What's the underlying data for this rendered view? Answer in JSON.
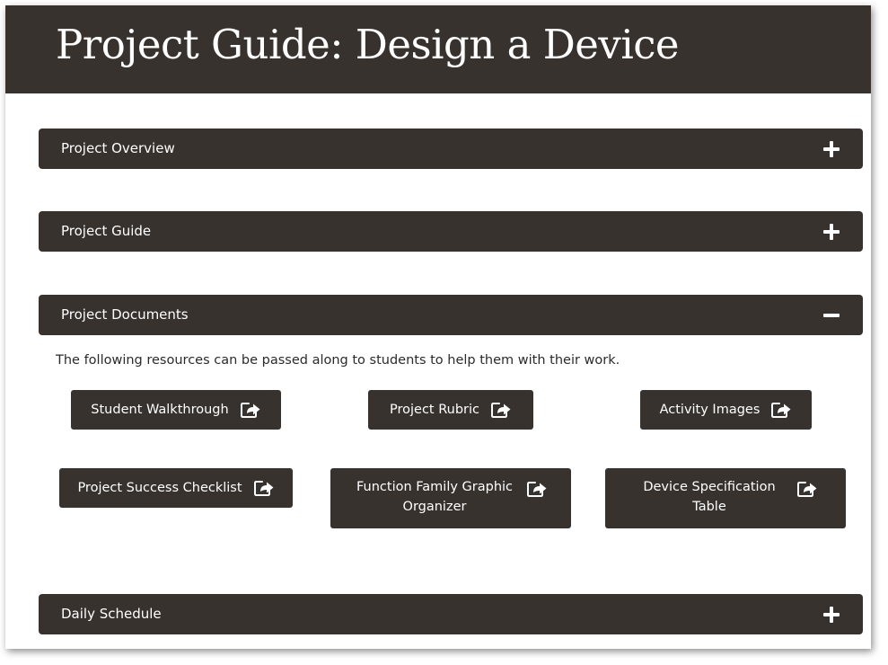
{
  "page": {
    "title": "Project Guide: Design a Device"
  },
  "accordion": [
    {
      "label": "Project Overview",
      "state": "collapsed",
      "toggle_icon": "plus-icon"
    },
    {
      "label": "Project Guide",
      "state": "collapsed",
      "toggle_icon": "plus-icon"
    },
    {
      "label": "Project Documents",
      "state": "expanded",
      "toggle_icon": "minus-icon"
    },
    {
      "label": "Daily Schedule",
      "state": "collapsed",
      "toggle_icon": "plus-icon"
    }
  ],
  "documents": {
    "intro": "The following resources can be passed along to students to help them with their work.",
    "resources": [
      {
        "label": "Student Walkthrough",
        "icon": "share-icon"
      },
      {
        "label": "Project Rubric",
        "icon": "share-icon"
      },
      {
        "label": "Activity Images",
        "icon": "share-icon"
      },
      {
        "label": "Project Success Checklist",
        "icon": "share-icon"
      },
      {
        "label": "Function Family Graphic Organizer",
        "icon": "share-icon"
      },
      {
        "label": "Device Specification Table",
        "icon": "share-icon"
      }
    ]
  },
  "colors": {
    "header_bg": "#38322e",
    "text_light": "#ffffff",
    "body_text": "#2b2b2b"
  }
}
